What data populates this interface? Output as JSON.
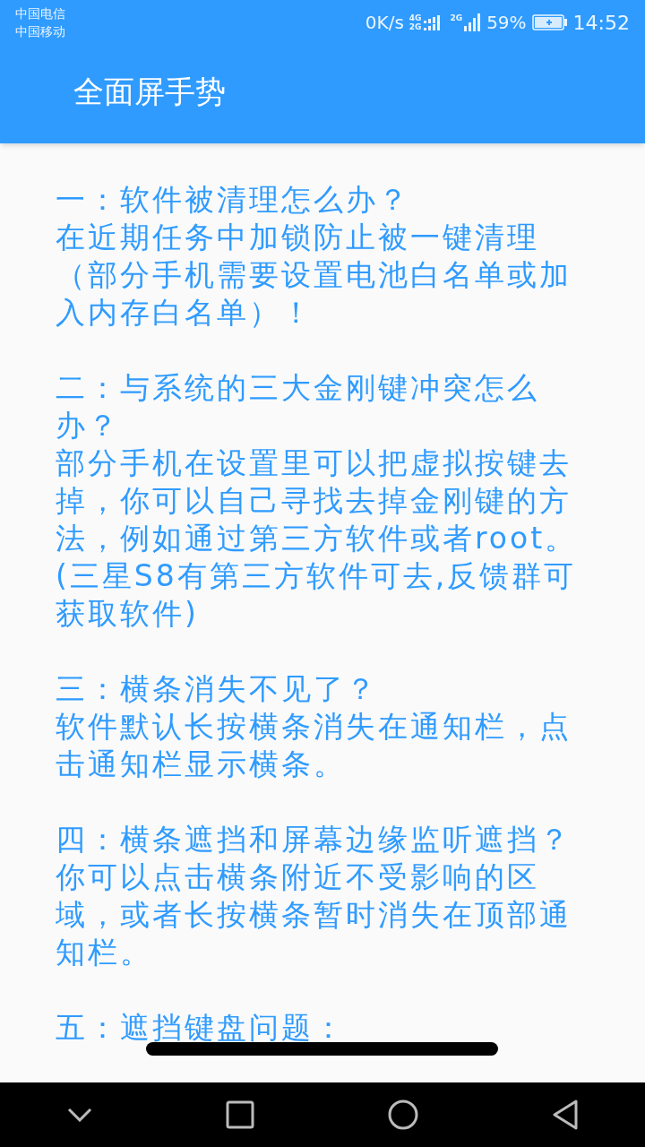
{
  "status_bar": {
    "carriers": [
      "中国电信",
      "中国移动"
    ],
    "speed": "0K/s",
    "network_1": "4G",
    "network_2": "2G",
    "network_3": "2G",
    "battery": "59%",
    "time": "14:52"
  },
  "app_bar": {
    "title": "全面屏手势"
  },
  "sections": [
    {
      "question": "一：软件被清理怎么办？",
      "answer": "在近期任务中加锁防止被一键清理（部分手机需要设置电池白名单或加入内存白名单）！"
    },
    {
      "question": "二：与系统的三大金刚键冲突怎么办？",
      "answer": "部分手机在设置里可以把虚拟按键去掉，你可以自己寻找去掉金刚键的方法，例如通过第三方软件或者root。(三星S8有第三方软件可去,反馈群可获取软件)"
    },
    {
      "question": "三：横条消失不见了？",
      "answer": "软件默认长按横条消失在通知栏，点击通知栏显示横条。"
    },
    {
      "question": "四：横条遮挡和屏幕边缘监听遮挡？",
      "answer": "你可以点击横条附近不受影响的区域，或者长按横条暂时消失在顶部通知栏。"
    },
    {
      "question": "五：遮挡键盘问题："
    }
  ]
}
